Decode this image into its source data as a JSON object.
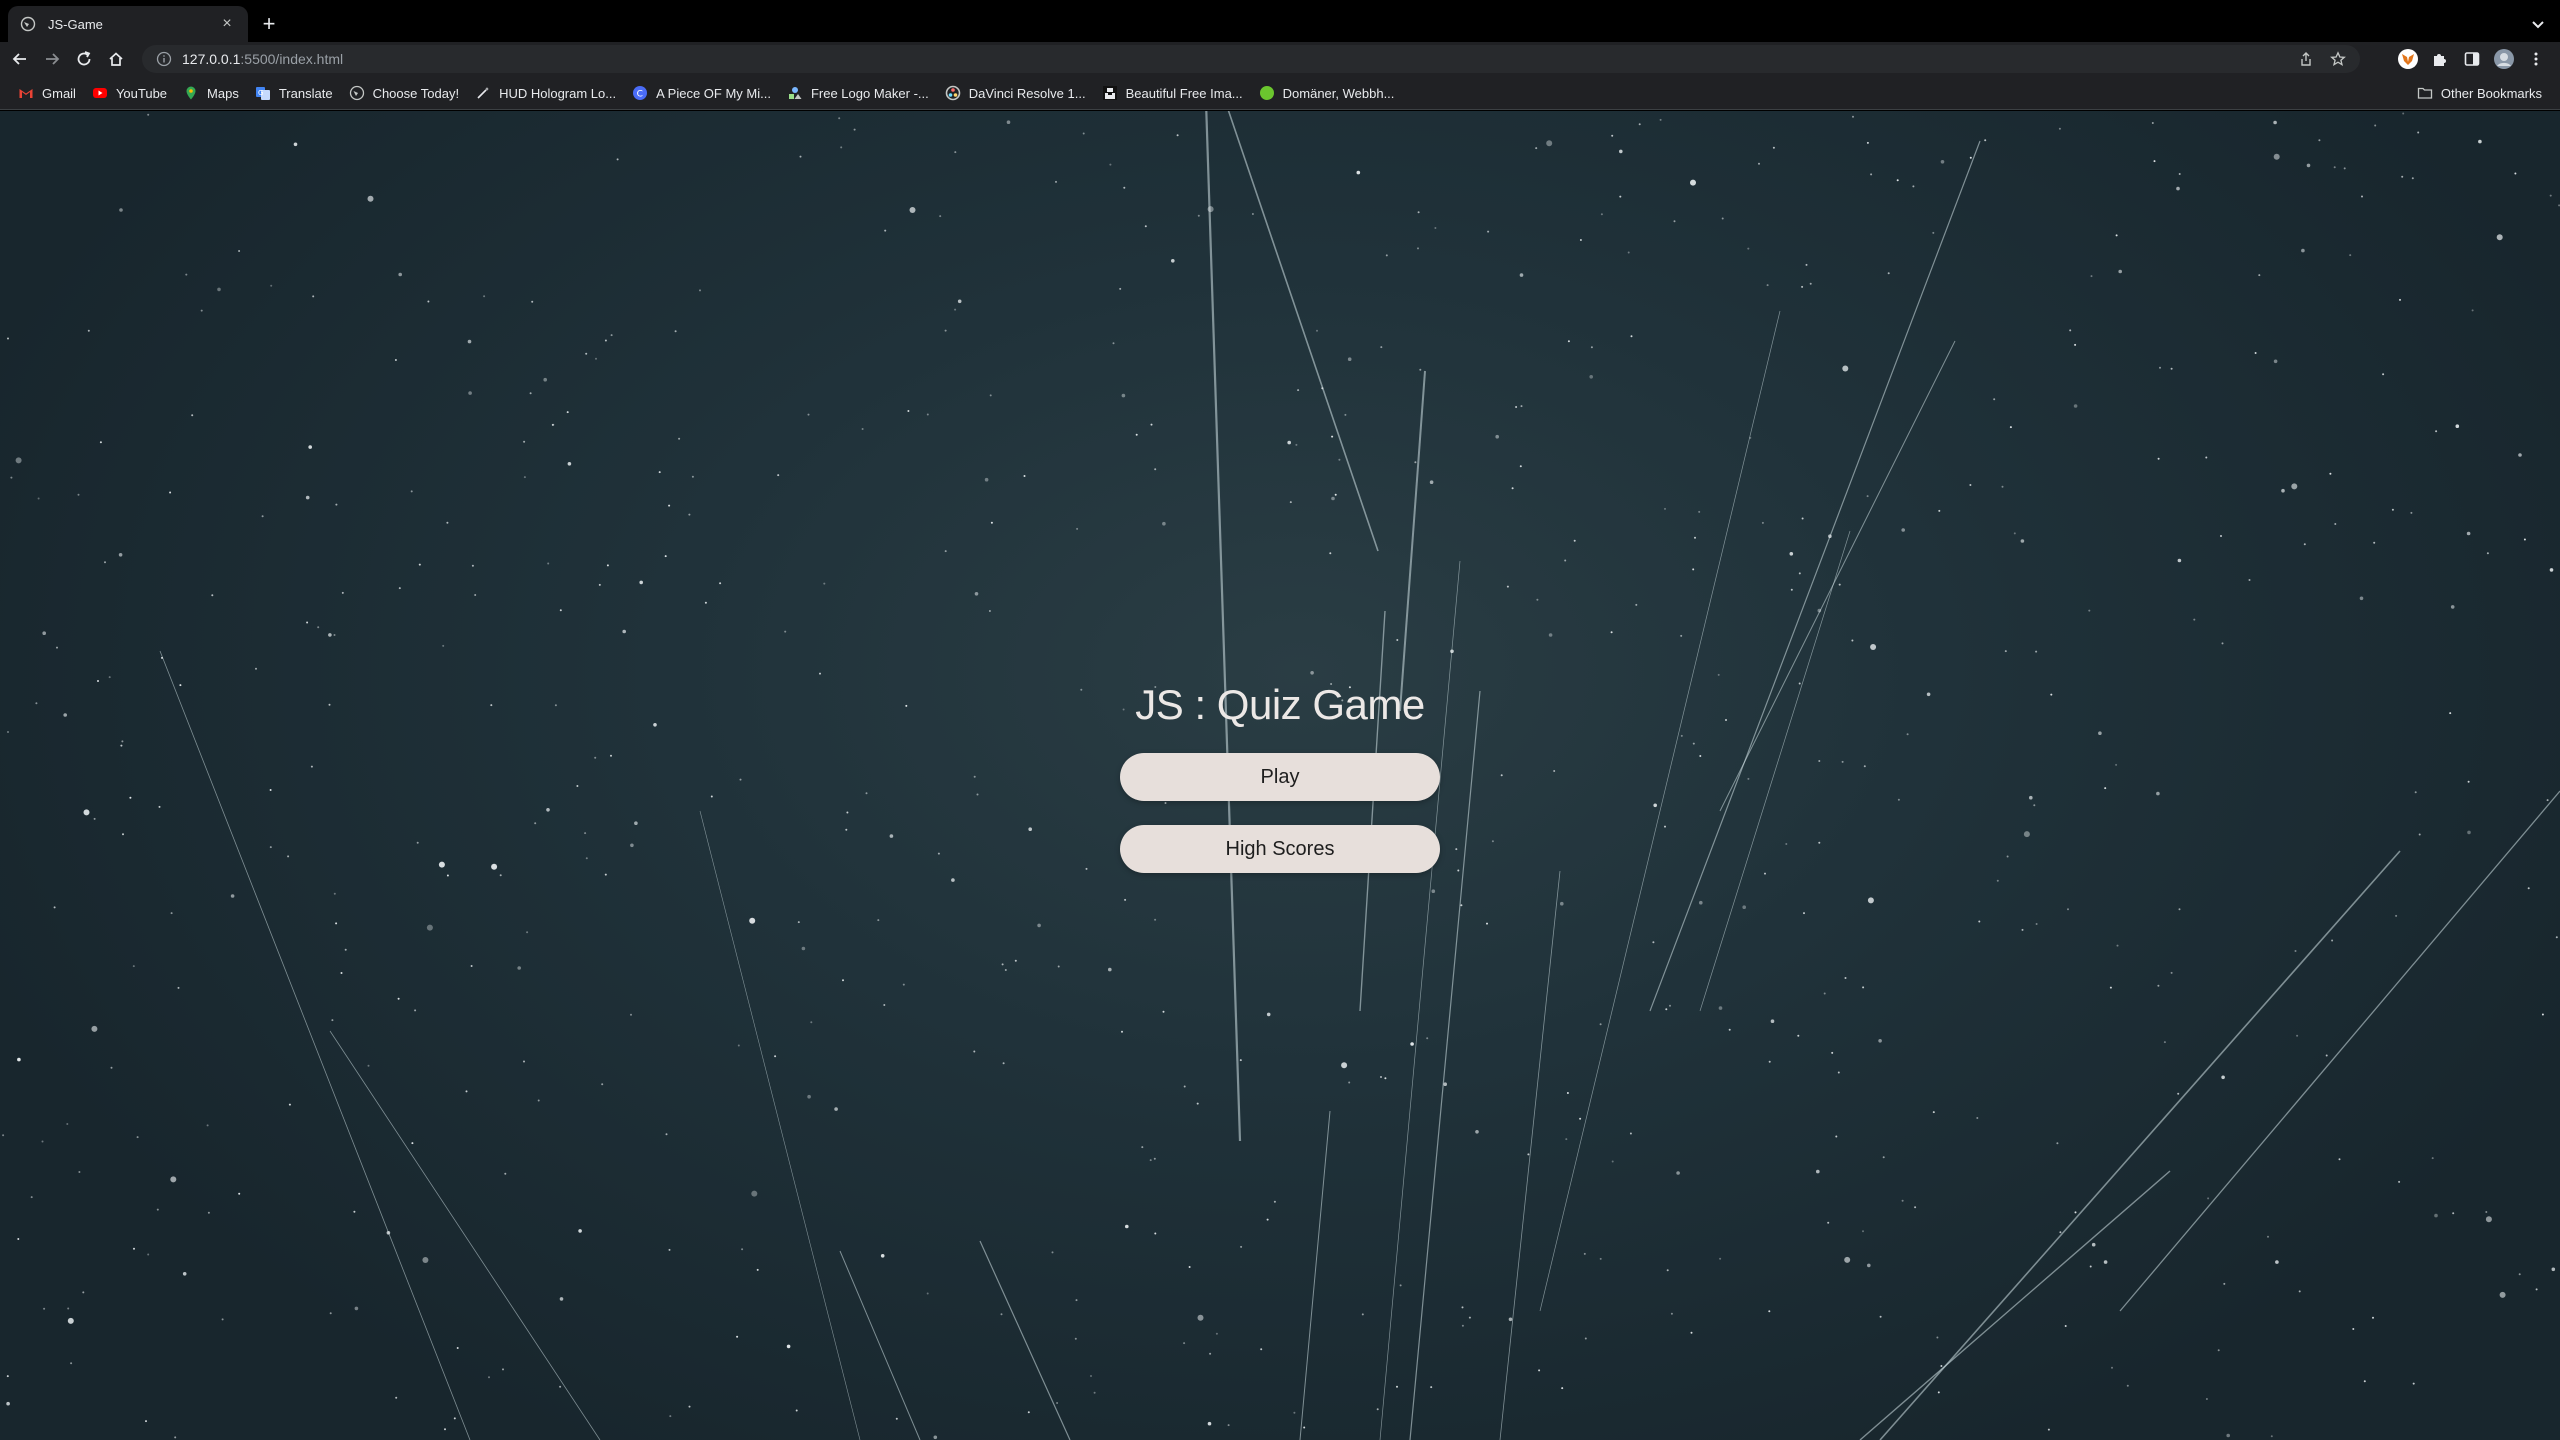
{
  "browser": {
    "tab": {
      "title": "JS-Game"
    },
    "url": {
      "host": "127.0.0.1",
      "path": ":5500/index.html"
    },
    "bookmarks": [
      {
        "label": "Gmail",
        "icon": "gmail-icon"
      },
      {
        "label": "YouTube",
        "icon": "youtube-icon"
      },
      {
        "label": "Maps",
        "icon": "maps-icon"
      },
      {
        "label": "Translate",
        "icon": "translate-icon"
      },
      {
        "label": "Choose Today!",
        "icon": "globe-icon"
      },
      {
        "label": "HUD Hologram Lo...",
        "icon": "wand-icon"
      },
      {
        "label": "A Piece OF My Mi...",
        "icon": "blog-icon"
      },
      {
        "label": "Free Logo Maker -...",
        "icon": "logo-maker-icon"
      },
      {
        "label": "DaVinci Resolve 1...",
        "icon": "davinci-icon"
      },
      {
        "label": "Beautiful Free Ima...",
        "icon": "unsplash-icon"
      },
      {
        "label": "Domäner, Webbh...",
        "icon": "green-dot-icon"
      }
    ],
    "other_bookmarks": "Other Bookmarks"
  },
  "page": {
    "title": "JS : Quiz Game",
    "play_label": "Play",
    "highscores_label": "High Scores"
  },
  "colors": {
    "button_bg": "#e7dfdb",
    "sky_dark": "#18262d",
    "sky_mid": "#2a3d44"
  }
}
